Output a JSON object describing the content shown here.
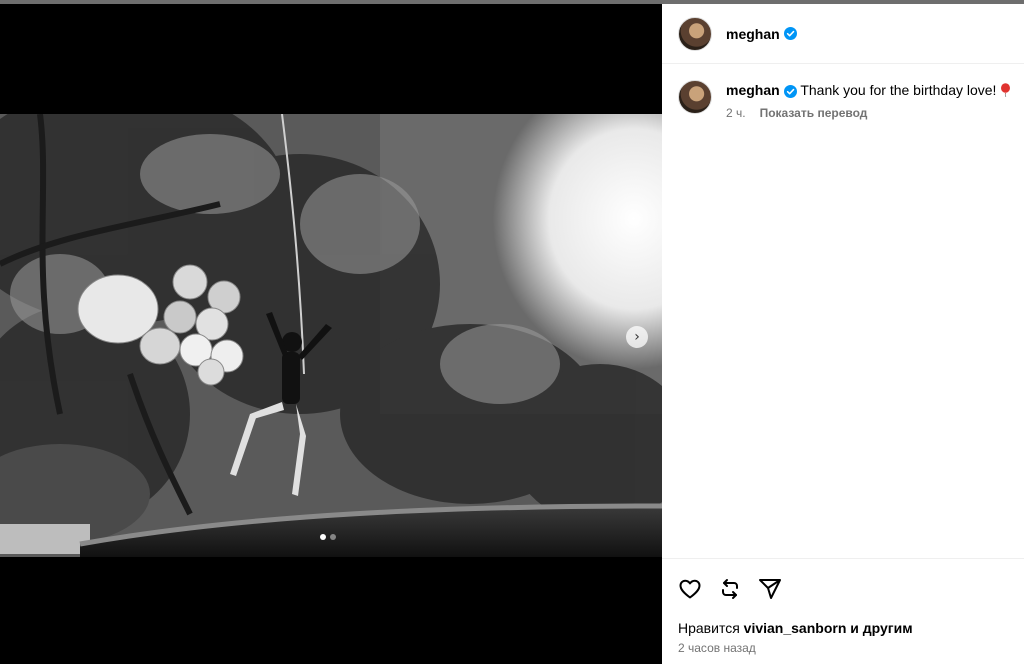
{
  "post": {
    "author": "meghan",
    "caption_text": "Thank you for the birthday love!",
    "caption_time": "2 ч.",
    "translate_label": "Показать перевод",
    "likes_prefix": "Нравится ",
    "likes_user": "vivian_sanborn",
    "likes_suffix": " и другим",
    "timestamp": "2 часов назад",
    "carousel_next": "›",
    "carousel_count": 2,
    "carousel_active_index": 0
  },
  "colors": {
    "verified_blue": "#0095f6",
    "muted_text": "#737373",
    "balloon_red": "#e0332f"
  },
  "icons": [
    "verified-icon",
    "heart-icon",
    "repost-icon",
    "share-icon",
    "balloon-emoji-icon",
    "chevron-right-icon"
  ]
}
